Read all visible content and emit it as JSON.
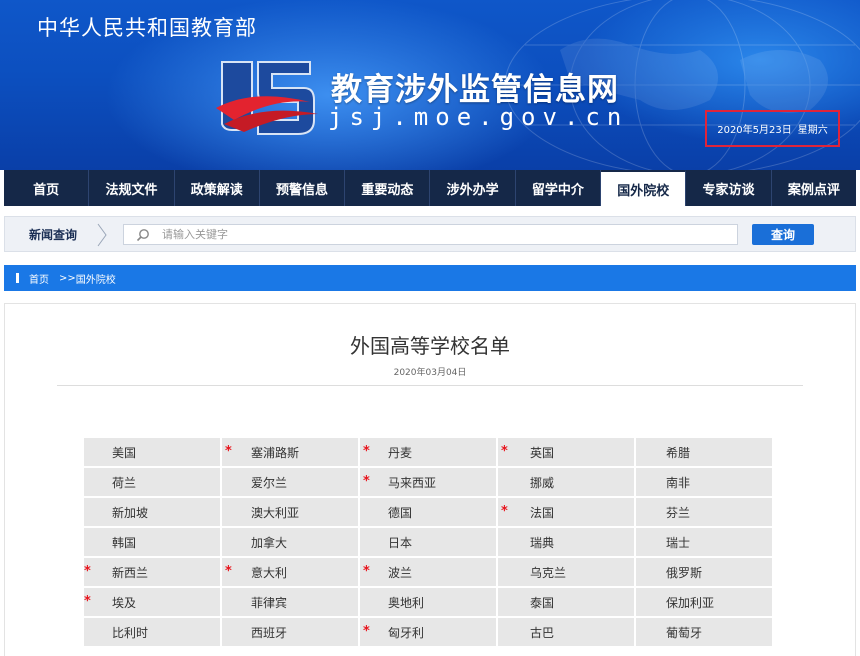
{
  "header": {
    "ministry_name": "中华人民共和国教育部",
    "site_title": "教育涉外监管信息网",
    "site_domain": "jsj.moe.gov.cn",
    "date": "2020年5月23日",
    "weekday": "星期六",
    "colors": {
      "banner": "#0c4fbf",
      "highlight_box": "#e0243a"
    }
  },
  "nav": {
    "items": [
      {
        "label": "首页"
      },
      {
        "label": "法规文件"
      },
      {
        "label": "政策解读"
      },
      {
        "label": "预警信息"
      },
      {
        "label": "重要动态"
      },
      {
        "label": "涉外办学"
      },
      {
        "label": "留学中介"
      },
      {
        "label": "国外院校",
        "active": true
      },
      {
        "label": "专家访谈"
      },
      {
        "label": "案例点评"
      }
    ],
    "colors": {
      "background": "#152848",
      "active_background": "#ffffff"
    }
  },
  "search": {
    "label": "新闻查询",
    "placeholder": "请输入关键字",
    "value": "",
    "button_label": "查询"
  },
  "breadcrumb": {
    "home": "首页",
    "separator": ">>",
    "current": "国外院校"
  },
  "article": {
    "title": "外国高等学校名单",
    "date": "2020年03月04日"
  },
  "countries": {
    "rows": [
      [
        {
          "name": "美国",
          "star": ""
        },
        {
          "name": "塞浦路斯",
          "star": "*"
        },
        {
          "name": "丹麦",
          "star": "*"
        },
        {
          "name": "英国",
          "star": "*"
        },
        {
          "name": "希腊",
          "star": ""
        }
      ],
      [
        {
          "name": "荷兰",
          "star": ""
        },
        {
          "name": "爱尔兰",
          "star": ""
        },
        {
          "name": "马来西亚",
          "star": "*"
        },
        {
          "name": "挪威",
          "star": ""
        },
        {
          "name": "南非",
          "star": ""
        }
      ],
      [
        {
          "name": "新加坡",
          "star": ""
        },
        {
          "name": "澳大利亚",
          "star": ""
        },
        {
          "name": "德国",
          "star": ""
        },
        {
          "name": "法国",
          "star": "*"
        },
        {
          "name": "芬兰",
          "star": ""
        }
      ],
      [
        {
          "name": "韩国",
          "star": ""
        },
        {
          "name": "加拿大",
          "star": ""
        },
        {
          "name": "日本",
          "star": ""
        },
        {
          "name": "瑞典",
          "star": ""
        },
        {
          "name": "瑞士",
          "star": ""
        }
      ],
      [
        {
          "name": "新西兰",
          "star": "*"
        },
        {
          "name": "意大利",
          "star": "*"
        },
        {
          "name": "波兰",
          "star": "*"
        },
        {
          "name": "乌克兰",
          "star": ""
        },
        {
          "name": "俄罗斯",
          "star": ""
        }
      ],
      [
        {
          "name": "埃及",
          "star": "*"
        },
        {
          "name": "菲律宾",
          "star": ""
        },
        {
          "name": "奥地利",
          "star": ""
        },
        {
          "name": "泰国",
          "star": ""
        },
        {
          "name": "保加利亚",
          "star": ""
        }
      ],
      [
        {
          "name": "比利时",
          "star": ""
        },
        {
          "name": "西班牙",
          "star": ""
        },
        {
          "name": "匈牙利",
          "star": "*"
        },
        {
          "name": "古巴",
          "star": ""
        },
        {
          "name": "葡萄牙",
          "star": ""
        }
      ]
    ],
    "colors": {
      "cell_background": "#e7e7e7",
      "star": "#e8141c"
    }
  }
}
